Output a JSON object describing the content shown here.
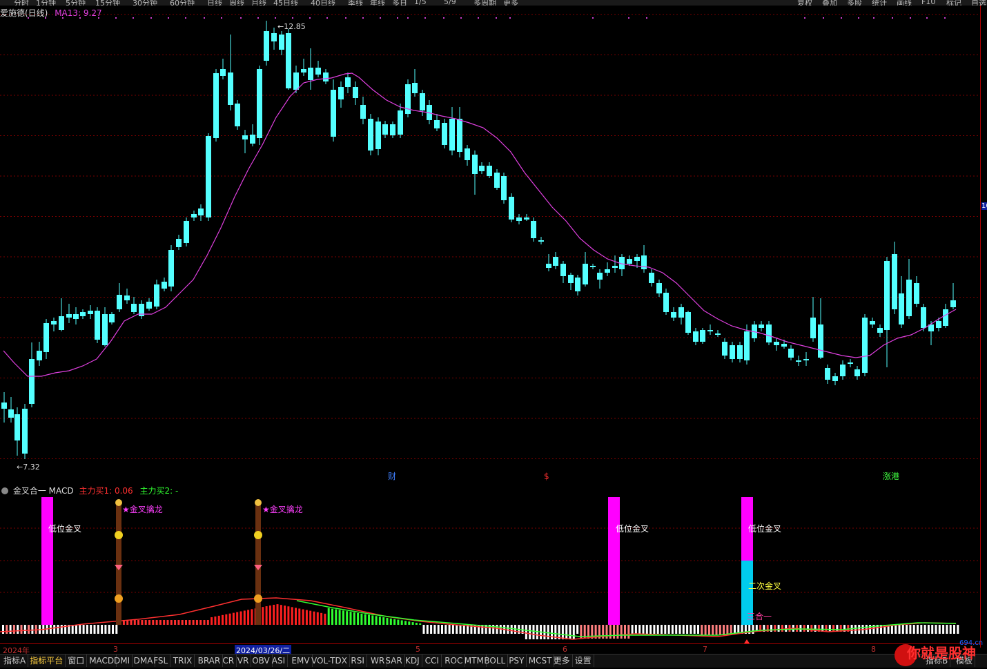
{
  "topbar": {
    "items": [
      "分时",
      "1分钟",
      "5分钟",
      "15分钟",
      "30分钟",
      "60分钟",
      "日线",
      "周线",
      "月线",
      "45日线",
      "40日线",
      "季线",
      "年线",
      "多日",
      "1/5",
      "5/9",
      "多周期",
      "更多"
    ],
    "right_items": [
      "复权",
      "叠加",
      "多股",
      "统计",
      "画线",
      "F10",
      "标记",
      "自选"
    ]
  },
  "chart_header": {
    "stock_name": "爱施德(日线)",
    "ma_label": "MA13: 9.27"
  },
  "price_labels": {
    "high": "12.85",
    "low": "7.32",
    "right_axis_marker": "10"
  },
  "event_markers": {
    "cai": "财",
    "dollar": "$",
    "zhang": "涨港"
  },
  "indicator_header": {
    "name": "金叉合一 MACD",
    "buy1": "主力买1: 0.06",
    "buy2": "主力买2: -"
  },
  "signals": {
    "low_cross": "低位金叉",
    "gold_dragon": "★金叉擒龙",
    "second_cross": "二次金叉",
    "triple_combo": "三合一"
  },
  "date_axis": {
    "labels": [
      "2024年",
      "3",
      "2024/03/26/二",
      "5",
      "6",
      "7",
      "8"
    ]
  },
  "bottom_tabs": [
    "指标A",
    "指标平台",
    "窗口",
    "MACD",
    "DMI",
    "DMA",
    "FSL",
    "TRIX",
    "BRAR",
    "CR",
    "VR",
    "OBV",
    "ASI",
    "EMV",
    "VOL-TDX",
    "RSI",
    "WR",
    "SAR",
    "KDJ",
    "CCI",
    "ROC",
    "MTM",
    "BOLL",
    "PSY",
    "MCST",
    "更多",
    "设置"
  ],
  "bottom_right_tabs": [
    "指标B",
    "模板"
  ],
  "watermark": {
    "text": "你就是股神",
    "domain": "694.cn"
  },
  "colors": {
    "up": "#ff3030",
    "down": "#54ffff",
    "ma": "#e040e0",
    "grid": "#7a0000",
    "signal_magenta": "#ff00ff",
    "signal_cyan": "#00ccee"
  }
}
